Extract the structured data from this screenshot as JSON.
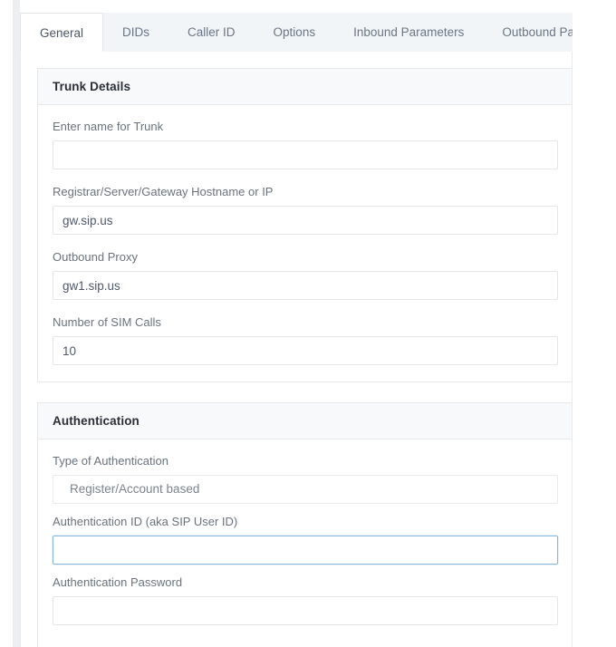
{
  "tabs": [
    {
      "label": "General",
      "active": true
    },
    {
      "label": "DIDs",
      "active": false
    },
    {
      "label": "Caller ID",
      "active": false
    },
    {
      "label": "Options",
      "active": false
    },
    {
      "label": "Inbound Parameters",
      "active": false
    },
    {
      "label": "Outbound Parameters",
      "active": false
    }
  ],
  "sections": {
    "trunk_details": {
      "title": "Trunk Details",
      "fields": {
        "trunk_name": {
          "label": "Enter name for Trunk",
          "value": "",
          "placeholder": ""
        },
        "registrar": {
          "label": "Registrar/Server/Gateway Hostname or IP",
          "value": "gw.sip.us",
          "placeholder": ""
        },
        "outbound_proxy": {
          "label": "Outbound Proxy",
          "value": "gw1.sip.us",
          "placeholder": ""
        },
        "sim_calls": {
          "label": "Number of SIM Calls",
          "value": "10",
          "placeholder": ""
        }
      }
    },
    "authentication": {
      "title": "Authentication",
      "fields": {
        "auth_type": {
          "label": "Type of Authentication",
          "value": "Register/Account based"
        },
        "auth_id": {
          "label": "Authentication ID (aka SIP User ID)",
          "value": "",
          "placeholder": ""
        },
        "auth_password": {
          "label": "Authentication Password",
          "value": "",
          "placeholder": ""
        }
      }
    }
  },
  "colors": {
    "focus_border": "#8ab8dc",
    "tab_bar_bg": "#f2f5f7",
    "card_header_bg": "#f8f9fa",
    "border": "#e6e9ec",
    "label_text": "#6a737d"
  }
}
